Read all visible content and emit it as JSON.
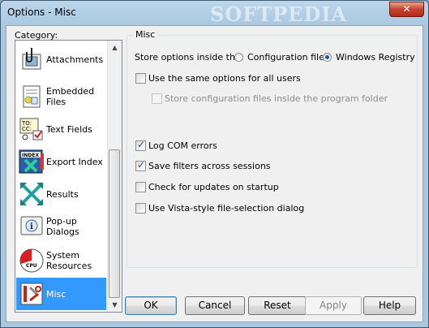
{
  "window": {
    "title": "Options - Misc",
    "watermark": "SOFTPEDIA",
    "close_glyph": "✕"
  },
  "category": {
    "label": "Category:",
    "items": [
      {
        "label": "Attachments",
        "icon": "attachment-icon",
        "selected": false
      },
      {
        "label": "Embedded Files",
        "icon": "embedded-files-icon",
        "selected": false
      },
      {
        "label": "Text Fields",
        "icon": "text-fields-icon",
        "selected": false
      },
      {
        "label": "Export Index",
        "icon": "export-index-icon",
        "selected": false
      },
      {
        "label": "Results",
        "icon": "results-icon",
        "selected": false
      },
      {
        "label": "Pop-up Dialogs",
        "icon": "popup-dialog-icon",
        "selected": false
      },
      {
        "label": "System Resources",
        "icon": "cpu-icon",
        "selected": false
      },
      {
        "label": "Misc",
        "icon": "misc-tools-icon",
        "selected": true
      }
    ]
  },
  "misc": {
    "group_title": "Misc",
    "store_label": "Store options inside the:",
    "radio_config": "Configuration file",
    "radio_registry": "Windows Registry",
    "selected_store": "Windows Registry",
    "same_options": {
      "label": "Use the same options for all users",
      "checked": false
    },
    "store_config_in_program": {
      "label": "Store configuration files inside the program folder",
      "checked": false,
      "enabled": false
    },
    "log_com": {
      "label": "Log COM errors",
      "checked": true
    },
    "save_filters": {
      "label": "Save filters across sessions",
      "checked": true
    },
    "check_updates": {
      "label": "Check for updates on startup",
      "checked": false
    },
    "vista_dialog": {
      "label": "Use Vista-style file-selection dialog",
      "checked": false
    }
  },
  "buttons": {
    "ok": "OK",
    "cancel": "Cancel",
    "reset": "Reset",
    "apply": "Apply",
    "help": "Help"
  }
}
